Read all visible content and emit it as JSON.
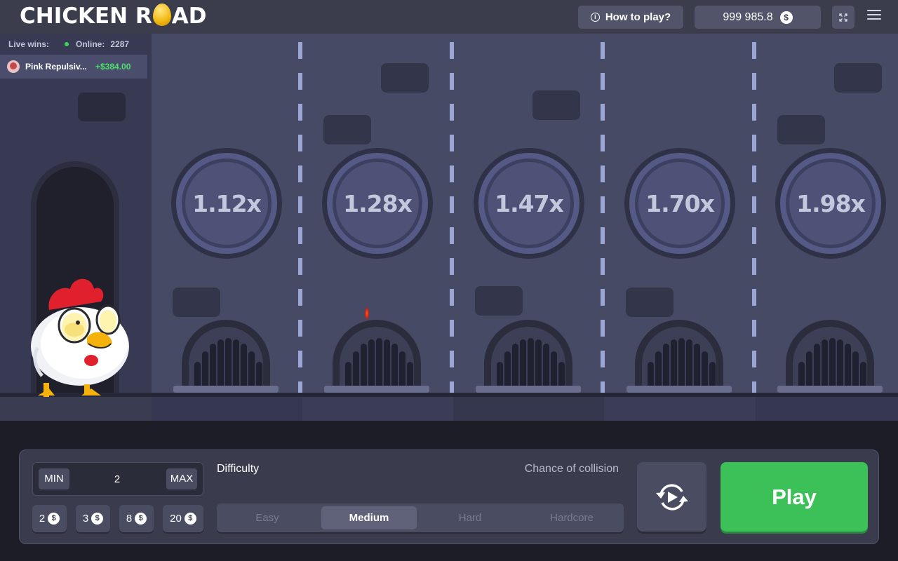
{
  "header": {
    "logo_part1": "CHICKEN R",
    "logo_part2": "AD",
    "how_to_play_label": "How to play?",
    "balance": "999 985.8",
    "currency_symbol": "$"
  },
  "live": {
    "live_wins_label": "Live wins:",
    "online_label": "Online:",
    "online_count": "2287",
    "latest_win": {
      "name": "Pink Repulsiv...",
      "amount": "+$384.00"
    }
  },
  "lanes": [
    {
      "multiplier": "1.12x"
    },
    {
      "multiplier": "1.28x"
    },
    {
      "multiplier": "1.47x"
    },
    {
      "multiplier": "1.70x"
    },
    {
      "multiplier": "1.98x"
    }
  ],
  "controls": {
    "min_label": "MIN",
    "max_label": "MAX",
    "bet_value": "2",
    "quick_bets": [
      "2",
      "3",
      "8",
      "20"
    ],
    "difficulty_label": "Difficulty",
    "chance_label": "Chance of collision",
    "difficulties": [
      "Easy",
      "Medium",
      "Hard",
      "Hardcore"
    ],
    "selected_difficulty": "Medium",
    "play_label": "Play"
  },
  "colors": {
    "play_button": "#3cc159",
    "win_amount": "#4be06a",
    "online_dot": "#3ed35b",
    "lane_background": "#474a64"
  }
}
